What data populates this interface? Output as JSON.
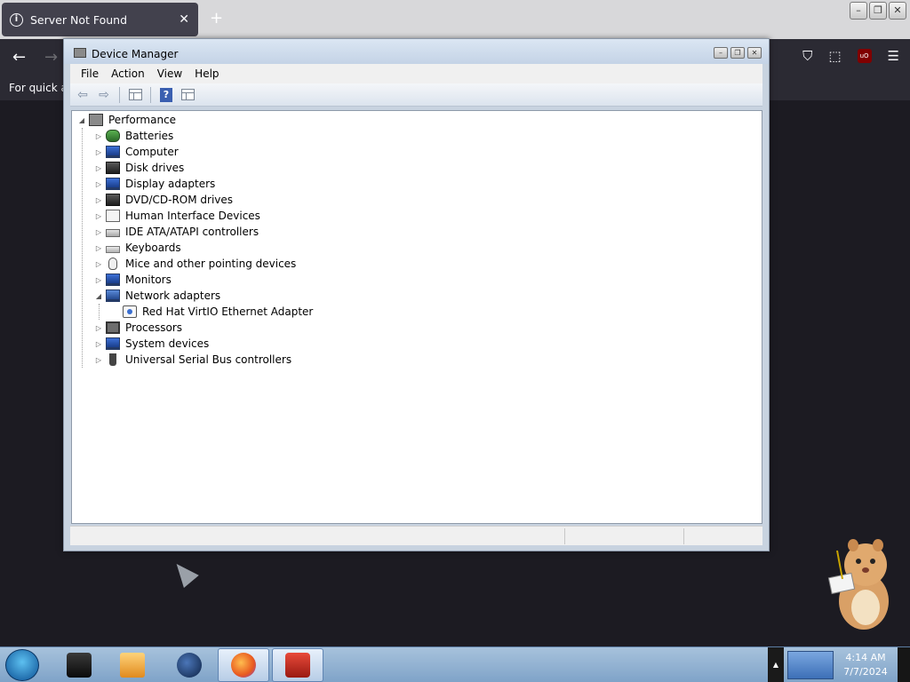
{
  "browser": {
    "tab_title": "Server Not Found",
    "tab_close": "✕",
    "new_tab": "+",
    "bookmarks_text": "For quick ac",
    "nav_back": "←",
    "nav_forward": "→",
    "nav_icons": [
      "pocket-icon",
      "extensions-icon",
      "ublock-icon",
      "menu-icon"
    ],
    "ublock_label": "uO",
    "menu_glyph": "☰",
    "pocket_glyph": "⛉",
    "extensions_glyph": "⬚"
  },
  "window_controls": {
    "minimize": "–",
    "restore": "❐",
    "close": "✕"
  },
  "device_manager": {
    "title": "Device Manager",
    "menu": [
      "File",
      "Action",
      "View",
      "Help"
    ],
    "toolbar": {
      "back": "⇦",
      "forward": "⇨",
      "help": "?"
    },
    "tree": {
      "root": "Performance",
      "items": [
        {
          "label": "Batteries",
          "icon": "battery-icon",
          "expanded": false
        },
        {
          "label": "Computer",
          "icon": "computer-icon",
          "expanded": false
        },
        {
          "label": "Disk drives",
          "icon": "disk-drive-icon",
          "expanded": false
        },
        {
          "label": "Display adapters",
          "icon": "display-adapter-icon",
          "expanded": false
        },
        {
          "label": "DVD/CD-ROM drives",
          "icon": "dvd-drive-icon",
          "expanded": false
        },
        {
          "label": "Human Interface Devices",
          "icon": "hid-icon",
          "expanded": false
        },
        {
          "label": "IDE ATA/ATAPI controllers",
          "icon": "ide-controller-icon",
          "expanded": false
        },
        {
          "label": "Keyboards",
          "icon": "keyboard-icon",
          "expanded": false
        },
        {
          "label": "Mice and other pointing devices",
          "icon": "mouse-icon",
          "expanded": false
        },
        {
          "label": "Monitors",
          "icon": "monitor-icon",
          "expanded": false
        },
        {
          "label": "Network adapters",
          "icon": "network-adapter-icon",
          "expanded": true,
          "children": [
            {
              "label": "Red Hat VirtIO Ethernet Adapter",
              "icon": "ethernet-adapter-icon"
            }
          ]
        },
        {
          "label": "Processors",
          "icon": "processor-icon",
          "expanded": false
        },
        {
          "label": "System devices",
          "icon": "system-device-icon",
          "expanded": false
        },
        {
          "label": "Universal Serial Bus controllers",
          "icon": "usb-icon",
          "expanded": false
        }
      ]
    }
  },
  "taskbar": {
    "apps": [
      "command-prompt-icon",
      "media-player-icon",
      "network-globe-icon",
      "firefox-icon",
      "device-manager-icon"
    ],
    "clock_time": "4:14 AM",
    "clock_date": "7/7/2024"
  },
  "colors": {
    "browser_tab": "#42414d",
    "browser_toolbar": "#2b2a33",
    "desktop": "#1c1b22",
    "window_frame": "#c8d3e0",
    "taskbar": "#8fb0d2"
  }
}
